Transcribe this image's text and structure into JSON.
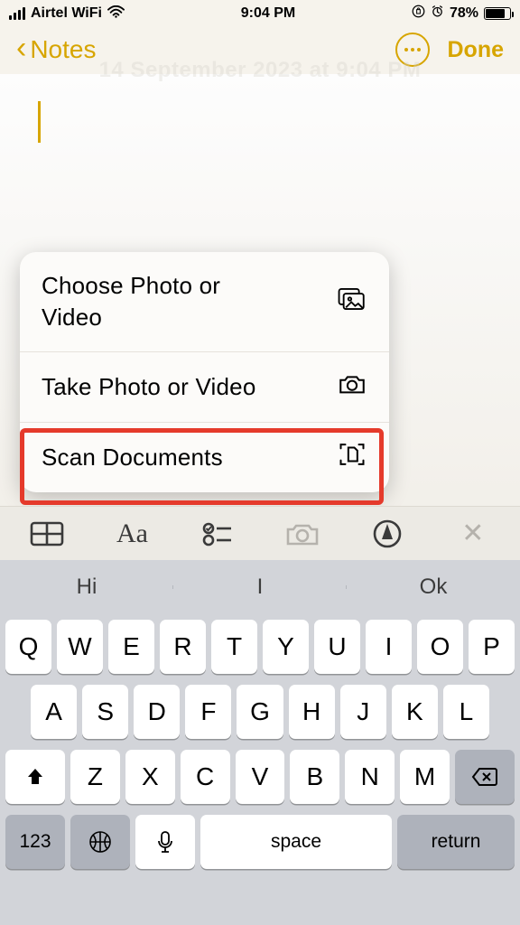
{
  "status": {
    "carrier": "Airtel WiFi",
    "time": "9:04 PM",
    "battery_pct": "78%"
  },
  "nav": {
    "back_label": "Notes",
    "done_label": "Done"
  },
  "ghost_date": "14 September 2023 at 9:04 PM",
  "sheet": {
    "choose": "Choose Photo or Video",
    "take": "Take Photo or Video",
    "scan": "Scan Documents"
  },
  "toolbar": {
    "text_format_label": "Aa"
  },
  "keyboard": {
    "predictions": [
      "Hi",
      "I",
      "Ok"
    ],
    "row1": [
      "Q",
      "W",
      "E",
      "R",
      "T",
      "Y",
      "U",
      "I",
      "O",
      "P"
    ],
    "row2": [
      "A",
      "S",
      "D",
      "F",
      "G",
      "H",
      "J",
      "K",
      "L"
    ],
    "row3": [
      "Z",
      "X",
      "C",
      "V",
      "B",
      "N",
      "M"
    ],
    "numbers_label": "123",
    "space_label": "space",
    "return_label": "return"
  }
}
